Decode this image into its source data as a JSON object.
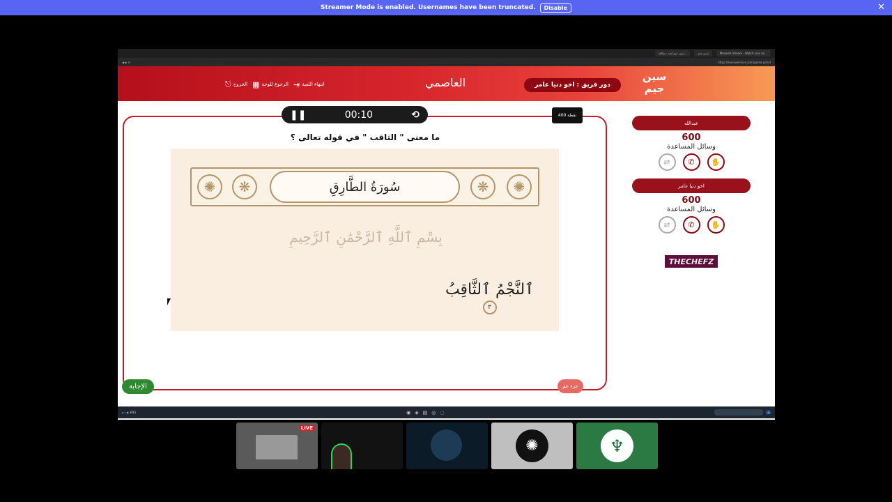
{
  "banner": {
    "text": "Streamer Mode is enabled. Usernames have been truncated.",
    "button": "Disable"
  },
  "browser": {
    "tabs": [
      "سين جيم لعبة - بطاقة...",
      "سين جيم",
      "Meowah Stream - Watch Live on..."
    ],
    "url": "https://seenjeemlive.com/game-panel"
  },
  "header": {
    "logo": "سين جيم",
    "team_turn": "دور فريق : اخو دنيا عامر",
    "title": "العاصمي",
    "links": {
      "end_game": "انتهاء اللعبة",
      "back_to_board": "الرجوع للوحة",
      "exit": "الخروج"
    }
  },
  "question_panel": {
    "timer": "00:10",
    "points": "400 نقطة",
    "question": "ما معنى \" الثاقب \" في قوله تعالى ؟",
    "surah_title": "سُورَةُ الطَّارِقِ",
    "basmala": "بِسْمِ ٱللَّهِ ٱلرَّحْمَٰنِ ٱلرَّحِيمِ",
    "ayah": "ٱلنَّجْمُ ٱلثَّاقِبُ",
    "ayah_number": "٣",
    "answer_button": "الإجابة",
    "part_button": "جزء عم"
  },
  "teams": [
    {
      "name": "عبدالله",
      "score": "600",
      "aids_label": "وسائل المساعدة"
    },
    {
      "name": "اخو دنيا عامر",
      "score": "600",
      "aids_label": "وسائل المساعدة"
    }
  ],
  "sponsor": {
    "part1": "THE",
    "part2": " CHEFZ"
  },
  "participants": {
    "live_label": "LIVE"
  },
  "colors": {
    "brand_red": "#c21f2b",
    "brand_orange": "#f79a55",
    "answer_green": "#2d8a2f",
    "discord_blurple": "#5865f2"
  }
}
